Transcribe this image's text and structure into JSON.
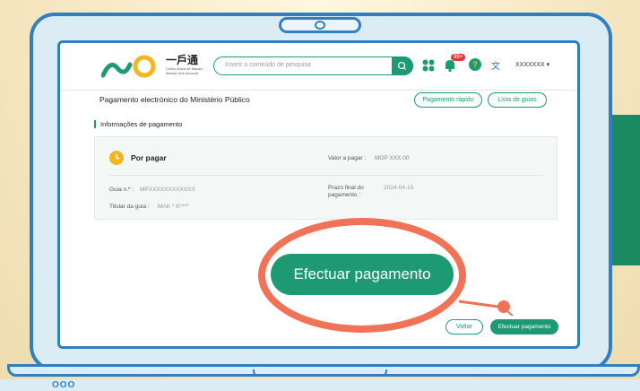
{
  "header": {
    "logo_name": "一戶通",
    "logo_sub1": "Conta Única de Macau",
    "logo_sub2": "Macao One Account",
    "search_placeholder": "Inserir o conteúdo de pesquisa",
    "notification_badge": "99+",
    "user_name": "XXXXXXX"
  },
  "page": {
    "title": "Pagamento electrónico do Ministério Público",
    "quick_pay_label": "Pagamento rápido",
    "guides_list_label": "Lista de guias",
    "section_label": "Informações de pagamento"
  },
  "payment": {
    "status": "Por pagar",
    "amount_label": "Valor a pagar :",
    "amount_value": "MOP XXX.00",
    "guide_no_label": "Guia n.º :",
    "guide_no_value": "MPXXXXXXXXXXXX",
    "holder_label": "Titular da guia :",
    "holder_value": "MAK * K****",
    "deadline_label_1": "Prazo final do",
    "deadline_label_2": "pagamento :",
    "deadline_value": "2024-04-15"
  },
  "actions": {
    "back_label": "Voltar",
    "pay_label": "Efectuar pagamento",
    "zoom_pay_label": "Efectuar pagamento"
  },
  "decor": {
    "laptop_dots": "OOO"
  },
  "colors": {
    "brand_green": "#1d9a72",
    "laptop_blue": "#2f7fc1",
    "callout_orange": "#f07257",
    "status_yellow": "#f3b61f"
  }
}
